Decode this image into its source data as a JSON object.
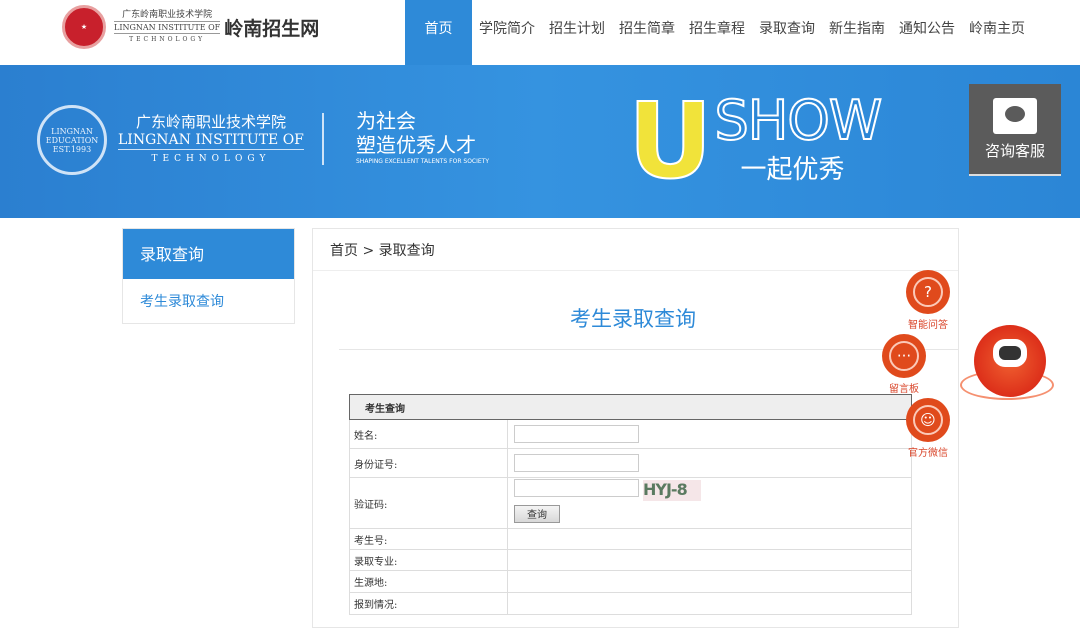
{
  "header": {
    "logo_cn": "广东岭南职业技术学院",
    "logo_en": "LINGNAN INSTITUTE OF",
    "logo_tech": "TECHNOLOGY",
    "site_name": "岭南招生网",
    "nav": [
      {
        "label": "首页",
        "active": true
      },
      {
        "label": "学院简介"
      },
      {
        "label": "招生计划"
      },
      {
        "label": "招生简章"
      },
      {
        "label": "招生章程"
      },
      {
        "label": "录取查询"
      },
      {
        "label": "新生指南"
      },
      {
        "label": "通知公告"
      },
      {
        "label": "岭南主页"
      }
    ]
  },
  "banner": {
    "seal_text": "LINGNAN EDUCATION EST.1993",
    "school_cn": "广东岭南职业技术学院",
    "school_en": "LINGNAN INSTITUTE OF",
    "school_tech": "TECHNOLOGY",
    "slogan_1": "为社会",
    "slogan_2": "塑造优秀人才",
    "slogan_en": "SHAPING EXCELLENT TALENTS FOR SOCIETY",
    "ushow_u": "U",
    "ushow_show": "SHOW",
    "ushow_cn": "一起优秀",
    "kefu": "咨询客服"
  },
  "sidebar": {
    "title": "录取查询",
    "items": [
      "考生录取查询"
    ]
  },
  "main": {
    "breadcrumb": "首页 > 录取查询",
    "title": "考生录取查询",
    "form": {
      "header": "考生查询",
      "name_label": "姓名:",
      "id_label": "身份证号:",
      "captcha_label": "验证码:",
      "captcha_text": "HYJ-8",
      "query_button": "查询",
      "result_labels": [
        "考生号:",
        "录取专业:",
        "生源地:",
        "报到情况:"
      ],
      "name_value": "",
      "id_value": "",
      "captcha_value": ""
    }
  },
  "floats": {
    "qa": "智能问答",
    "msg": "留言板",
    "wechat": "官方微信"
  }
}
